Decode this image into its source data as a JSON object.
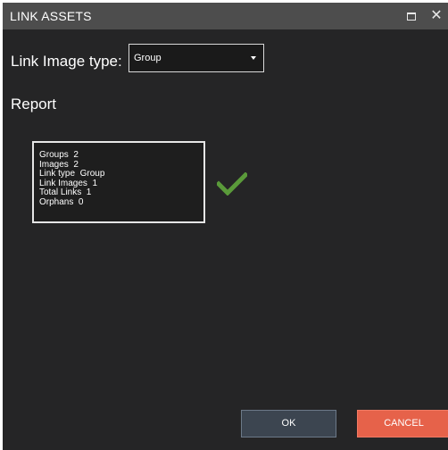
{
  "window": {
    "title": "LINK ASSETS",
    "maximize_icon": "maximize-icon",
    "close_glyph": "✕"
  },
  "link_image_type": {
    "label": "Link Image type:",
    "selected": "Group"
  },
  "report": {
    "heading": "Report",
    "lines": [
      "Groups  2",
      "Images  2",
      "Link type  Group",
      "Link Images  1",
      "Total Links  1",
      "Orphans  0"
    ],
    "status_icon": "checkmark-icon",
    "status_color": "#5a9a3a"
  },
  "buttons": {
    "ok": "OK",
    "cancel": "CANCEL"
  },
  "colors": {
    "titlebar": "#4d4d4d",
    "background": "#252526",
    "cancel": "#e6624a",
    "ok": "#3c4550"
  }
}
